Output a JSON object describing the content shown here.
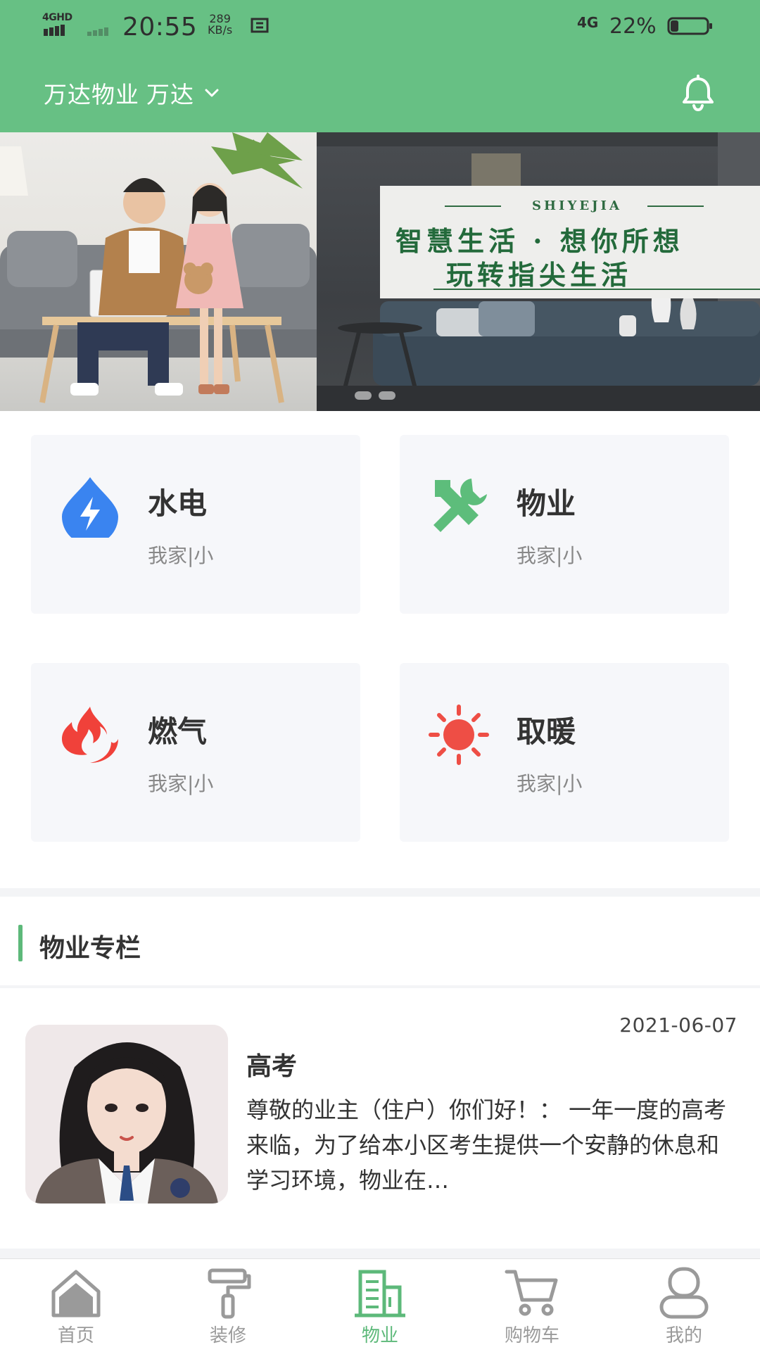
{
  "status_bar": {
    "network_label": "4GHD",
    "time": "20:55",
    "speed_value": "289",
    "speed_unit": "KB/s",
    "network_type": "4G",
    "battery_percent": "22%",
    "battery_level": 0.22
  },
  "header": {
    "company": "万达物业",
    "community": "万达",
    "bell_icon": "bell-icon"
  },
  "banner": {
    "slides": [
      {
        "id": "family-laptop"
      },
      {
        "sign_en": "SHIYEJIA",
        "sign_line1": "智慧生活 · 想你所想",
        "sign_line2": "玩转指尖生活"
      }
    ],
    "active_index": 0
  },
  "services": [
    {
      "title": "水电",
      "subtitle": "我家|小",
      "icon": "water-electric-icon",
      "color": "#3a84f0"
    },
    {
      "title": "物业",
      "subtitle": "我家|小",
      "icon": "tools-icon",
      "color": "#5dbd7b"
    },
    {
      "title": "燃气",
      "subtitle": "我家|小",
      "icon": "flame-icon",
      "color": "#f0413a"
    },
    {
      "title": "取暖",
      "subtitle": "我家|小",
      "icon": "sun-icon",
      "color": "#ee4e45"
    }
  ],
  "property_column": {
    "title": "物业专栏",
    "articles": [
      {
        "date": "2021-06-07",
        "title": "高考",
        "excerpt": "尊敬的业主（住户）你们好！： 一年一度的高考来临，为了给本小区考生提供一个安静的休息和学习环境，物业在…"
      }
    ]
  },
  "tabbar": {
    "tabs": [
      {
        "label": "首页",
        "icon": "home-icon"
      },
      {
        "label": "装修",
        "icon": "paint-roller-icon"
      },
      {
        "label": "物业",
        "icon": "building-icon"
      },
      {
        "label": "购物车",
        "icon": "cart-icon"
      },
      {
        "label": "我的",
        "icon": "user-icon"
      }
    ],
    "active_index": 2
  },
  "colors": {
    "brand_green": "#67c084",
    "accent_green": "#5db97a",
    "muted_text": "#9a9a9a"
  }
}
